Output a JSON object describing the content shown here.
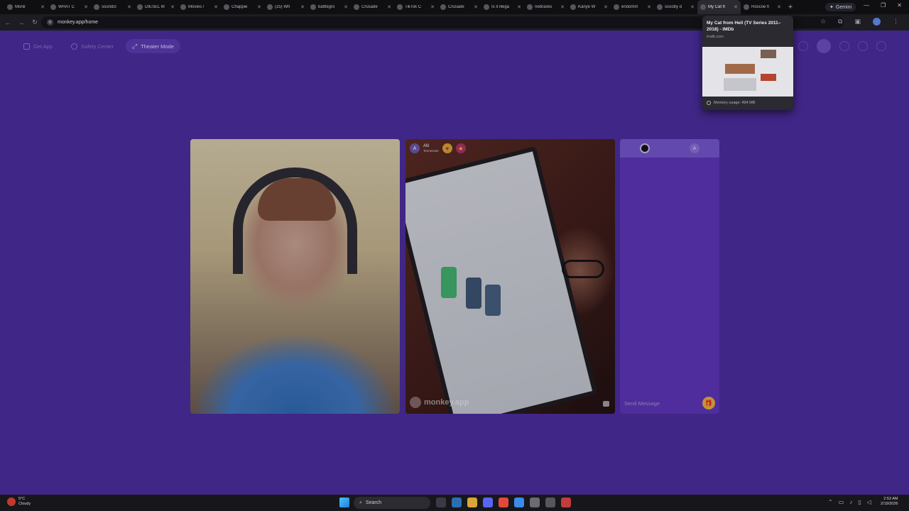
{
  "browser": {
    "tabs": [
      {
        "title": "Monk",
        "active": false
      },
      {
        "title": "WHAT C",
        "active": false
      },
      {
        "title": "soundcl",
        "active": false
      },
      {
        "title": "DIESEL M",
        "active": false
      },
      {
        "title": "Movies /",
        "active": false
      },
      {
        "title": "Chappie",
        "active": false
      },
      {
        "title": "(25) Wh",
        "active": false
      },
      {
        "title": "battlegro",
        "active": false
      },
      {
        "title": "Crusade",
        "active": false
      },
      {
        "title": "TikTok C",
        "active": false
      },
      {
        "title": "Crusade",
        "active": false
      },
      {
        "title": "Is it illega",
        "active": false
      },
      {
        "title": "nebrasks",
        "active": false
      },
      {
        "title": "Kanye W",
        "active": false
      },
      {
        "title": "endomm",
        "active": false
      },
      {
        "title": "scooby d",
        "active": false
      },
      {
        "title": "My Cat fr",
        "active": true
      },
      {
        "title": "Roscoe h",
        "active": false
      }
    ],
    "new_tab": "+",
    "gemini_label": "Gemini",
    "url": "monkey.app/home"
  },
  "hover_card": {
    "title": "My Cat from Hell (TV Series 2011–2018) - IMDb",
    "domain": "imdb.com",
    "memory": "Memory usage: 494 MB"
  },
  "page": {
    "nav": {
      "get_app": "Get App",
      "safety_center": "Safety Center",
      "theater_mode": "Theater Mode"
    },
    "remote_user": {
      "avatar_letter": "A",
      "name": "Alli",
      "subtitle": "Tennessee"
    },
    "watermark": "monkey.app",
    "chat": {
      "partner_letter": "A",
      "input_placeholder": "Send Message"
    }
  },
  "taskbar": {
    "weather_temp": "5°C",
    "weather_desc": "Cloudy",
    "search_label": "Search",
    "time": "2:53 AM",
    "date": "2/19/2026"
  },
  "colors": {
    "page_bg": "#4a2c9c",
    "chat_bg": "#5c35b6",
    "theater_pill": "#5b3bb1"
  }
}
